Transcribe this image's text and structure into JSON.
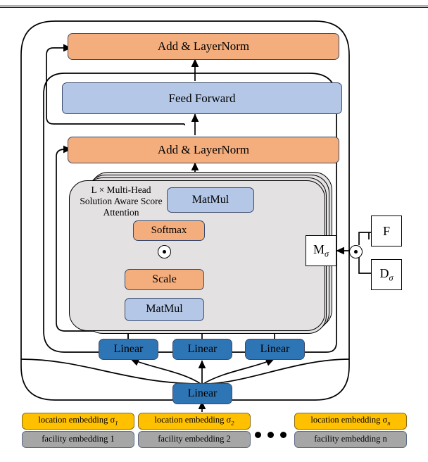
{
  "figure": {
    "title": "Solution Aware Score Attention Transformer Encoder",
    "domain": "diagram"
  },
  "palette": {
    "orange": "#F4AE7D",
    "light_blue": "#B4C7E7",
    "dark_blue": "#2E75B6",
    "yellow": "#FFC000",
    "grey": "#A6A6A6",
    "container_grey": "#E3E1E1",
    "stroke": "#000000",
    "box_border": "#3A4A6B"
  },
  "blocks": {
    "add_layernorm_top": "Add & LayerNorm",
    "feed_forward": "Feed Forward",
    "add_layernorm_mid": "Add & LayerNorm",
    "matmul_top": "MatMul",
    "softmax": "Softmax",
    "scale": "Scale",
    "matmul_bottom": "MatMul",
    "attention_label": "L × Multi-Head\nSolution Aware Score\nAttention"
  },
  "linear_layers": {
    "q": "Linear",
    "k": "Linear",
    "v": "Linear",
    "shared": "Linear"
  },
  "side_nodes": {
    "mask": "M",
    "mask_sub": "σ",
    "flow": "F",
    "distance": "D",
    "distance_sub": "σ"
  },
  "operators": {
    "hadamard_inner": "⊙",
    "hadamard_outer": "⊙"
  },
  "embeddings": [
    {
      "location": "location embedding σ",
      "location_sub": "1",
      "facility": "facility embedding 1"
    },
    {
      "location": "location embedding σ",
      "location_sub": "2",
      "facility": "facility embedding 2"
    },
    {
      "location": "location embedding σ",
      "location_sub": "n",
      "facility": "facility embedding n"
    }
  ],
  "ellipsis": "• • •"
}
